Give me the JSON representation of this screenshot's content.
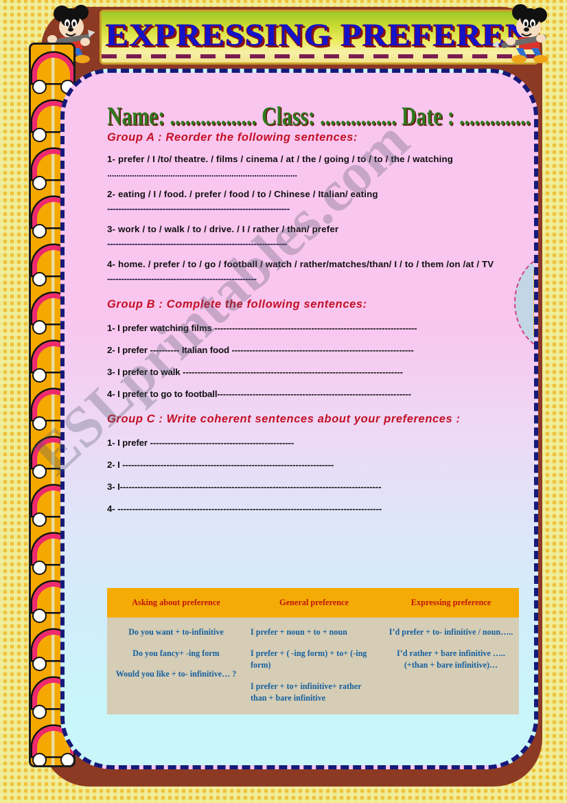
{
  "title": "EXPRESSING PREFERENCES",
  "header": {
    "nameline": "Name: ................. Class: ...............  Date : ..............",
    "name_label": "Name:",
    "class_label": "Class:",
    "date_label": "Date :",
    "dots": "................."
  },
  "watermark": "ESLprintables.com",
  "groups": [
    {
      "heading": "Group A : Reorder the following sentences:",
      "items": [
        "1- prefer / I /to/ theatre. / films / cinema / at / the / going / to / to / the / watching",
        "2-  eating / I / food. / prefer / food / to / Chinese / Italian/ eating",
        "3- work / to / walk / to / drive. / I / rather / than/ prefer",
        "4- home. / prefer / to / go / football / watch / rather/matches/than/ I / to / them /on /at / TV"
      ],
      "rules": [
        "....................................................................................",
        "------------------------------------------------------------------",
        "-----------------------------------------------------------------",
        "------------------------------------------------------"
      ]
    },
    {
      "heading": "Group B : Complete the following sentences:",
      "items": [
        "1- I prefer watching films ---------------------------------------------------------------------",
        "2-  I prefer ---------- Italian food --------------------------------------------------------------",
        "3- I prefer to walk ---------------------------------------------------------------------------",
        "4- I prefer to go to football------------------------------------------------------------------"
      ]
    },
    {
      "heading": "Group C : Write coherent  sentences about your preferences  :",
      "items": [
        "1- I prefer -------------------------------------------------",
        "2- I ------------------------------------------------------------------------",
        "3- I-----------------------------------------------------------------------------------------",
        "4- ------------------------------------------------------------------------------------------"
      ]
    }
  ],
  "reference_table": {
    "headers": [
      "Asking about preference",
      "General preference",
      "Expressing preference"
    ],
    "columns": [
      [
        "Do you want + to-infinitive",
        "Do you fancy+ -ing form",
        "Would you like + to- infinitive… ?"
      ],
      [
        "I prefer + noun + to + noun",
        "I prefer + ( -ing form) + to+ (-ing form)",
        "I prefer + to+ infinitive+ rather than + bare infinitive"
      ],
      [
        "I’d prefer + to- infinitive / noun…..",
        "I’d rather + bare infinitive …..(+than + bare infinitive)…"
      ]
    ]
  },
  "colors": {
    "background_check_gold": "#efc23a",
    "background_check_pale": "#f0f0a0",
    "brown_card": "#8d3a24",
    "sheet_border_navy": "#151a7a",
    "title_blue": "#1313c8",
    "title_shadow_red": "#8b1010",
    "heading_crimson": "#c30f25",
    "nameline_green": "#2f7a1f",
    "spiral_orange": "#f5a800",
    "spiral_ring_pink": "#ee2a6e",
    "table_header_gold": "#f5ab05",
    "table_header_red": "#c0150f",
    "table_body_tan": "#d5cdb6",
    "table_body_blue": "#17609e",
    "food_oval_blue": "#c3d6e8",
    "food_oval_dash_pink": "#d5407e"
  },
  "decor": {
    "mickey_left": "mickey-mouse-with-pencil",
    "mickey_right": "mickey-mouse-with-pencil",
    "food_image": "grid-of-food-dishes",
    "spiral_binding": "spiral-notebook-rings"
  },
  "food_cells": [
    "#f2d8c8",
    "#e8654d",
    "#3b2a2a",
    "#b8743c",
    "#8a4b2c",
    "#f0d9c5",
    "#e8a23c",
    "#f2efc4",
    "#e6c4a8",
    "#e8c070",
    "#e8a850",
    "#d9a03c"
  ]
}
